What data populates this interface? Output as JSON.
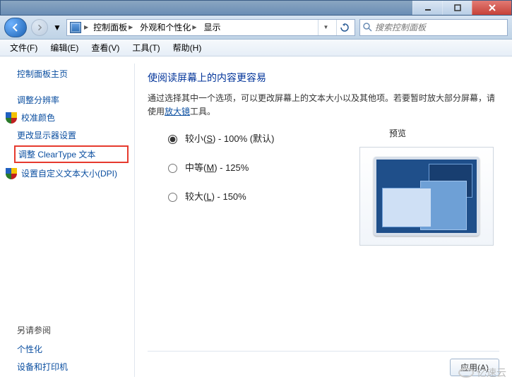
{
  "titlebar": {
    "min_label": "min",
    "max_label": "max",
    "close_label": "close"
  },
  "nav": {
    "crumbs": [
      "控制面板",
      "外观和个性化",
      "显示"
    ],
    "search_placeholder": "搜索控制面板"
  },
  "menu": {
    "file": "文件(F)",
    "edit": "编辑(E)",
    "view": "查看(V)",
    "tools": "工具(T)",
    "help": "帮助(H)"
  },
  "sidebar": {
    "home": "控制面板主页",
    "items": [
      {
        "label": "调整分辨率",
        "icon": null
      },
      {
        "label": "校准颜色",
        "icon": "shield"
      },
      {
        "label": "更改显示器设置",
        "icon": null
      },
      {
        "label": "调整 ClearType 文本",
        "icon": null,
        "highlighted": true
      },
      {
        "label": "设置自定义文本大小(DPI)",
        "icon": "shield"
      }
    ],
    "see_also_title": "另请参阅",
    "see_also": [
      "个性化",
      "设备和打印机"
    ]
  },
  "content": {
    "heading": "使阅读屏幕上的内容更容易",
    "desc_prefix": "通过选择其中一个选项，可以更改屏幕上的文本大小以及其他项。若要暂时放大部分屏幕，请使用",
    "desc_link": "放大镜",
    "desc_suffix": "工具。",
    "options": [
      {
        "value": "smaller",
        "label_pre": "较小(",
        "label_key": "S",
        "label_post": ") - 100% (默认)",
        "checked": true
      },
      {
        "value": "medium",
        "label_pre": "中等(",
        "label_key": "M",
        "label_post": ") - 125%",
        "checked": false
      },
      {
        "value": "larger",
        "label_pre": "较大(",
        "label_key": "L",
        "label_post": ") - 150%",
        "checked": false
      }
    ],
    "preview_label": "预览",
    "apply_label": "应用(A)"
  },
  "watermark": "亿速云"
}
